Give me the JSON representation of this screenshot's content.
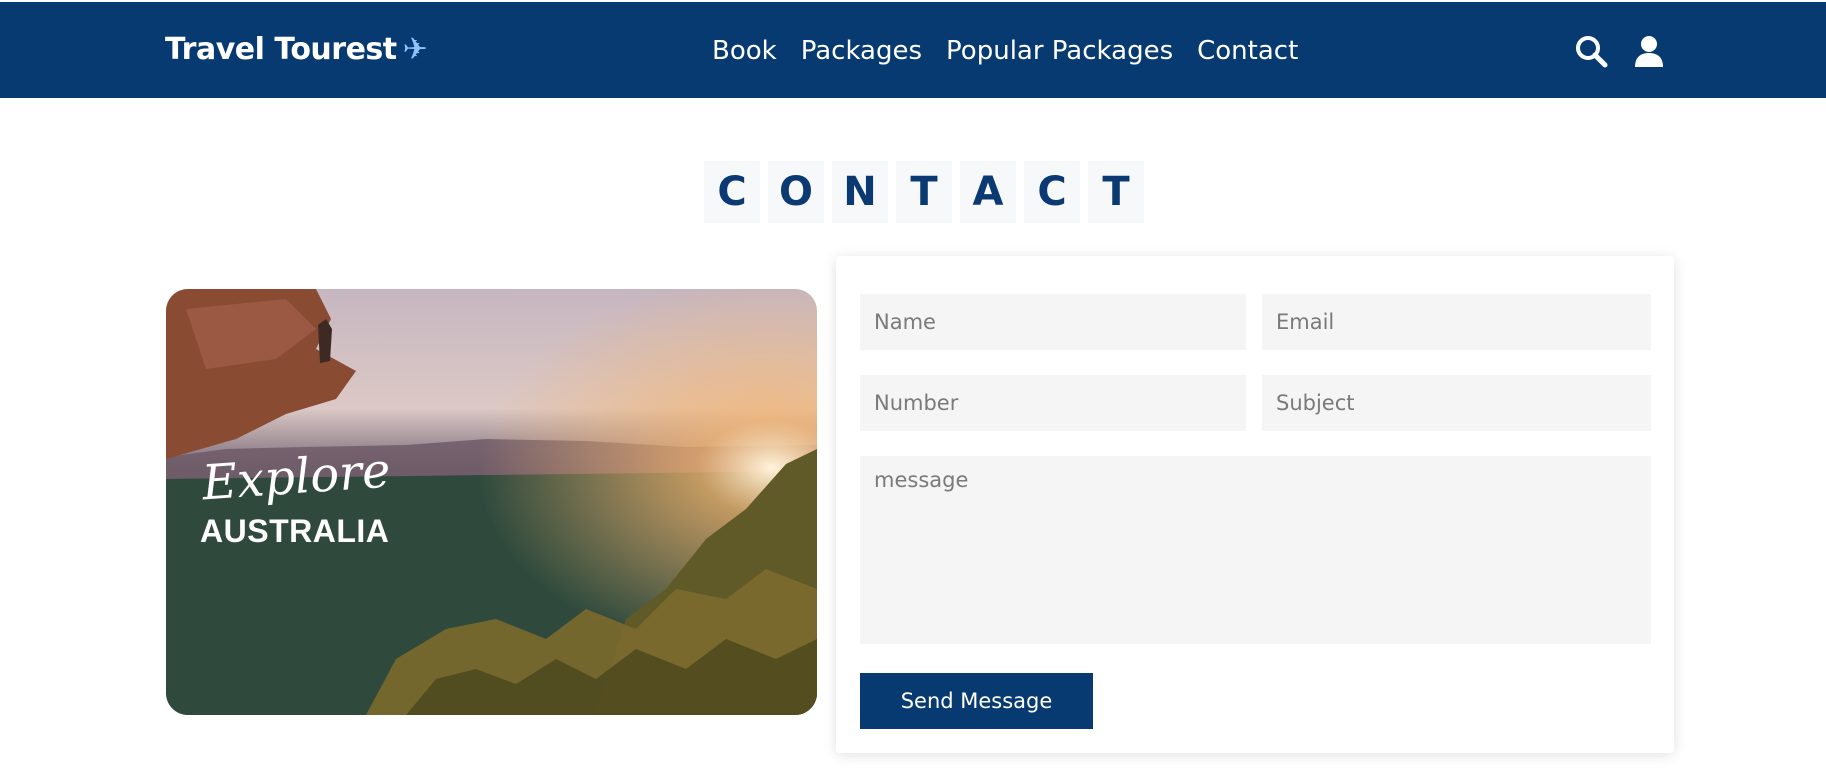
{
  "header": {
    "logo_text": "Travel Tourest",
    "logo_icon": "airplane-icon",
    "nav": [
      {
        "label": "Book"
      },
      {
        "label": "Packages"
      },
      {
        "label": "Popular Packages"
      },
      {
        "label": "Contact"
      }
    ],
    "icons": [
      "search-icon",
      "user-icon"
    ],
    "bg_color": "#083a72"
  },
  "section": {
    "title_letters": [
      "C",
      "O",
      "N",
      "T",
      "A",
      "C",
      "T"
    ]
  },
  "image": {
    "script_text": "Explore",
    "country_text": "AUSTRALIA"
  },
  "form": {
    "name_placeholder": "Name",
    "email_placeholder": "Email",
    "number_placeholder": "Number",
    "subject_placeholder": "Subject",
    "message_placeholder": "message",
    "submit_label": "Send Message"
  }
}
